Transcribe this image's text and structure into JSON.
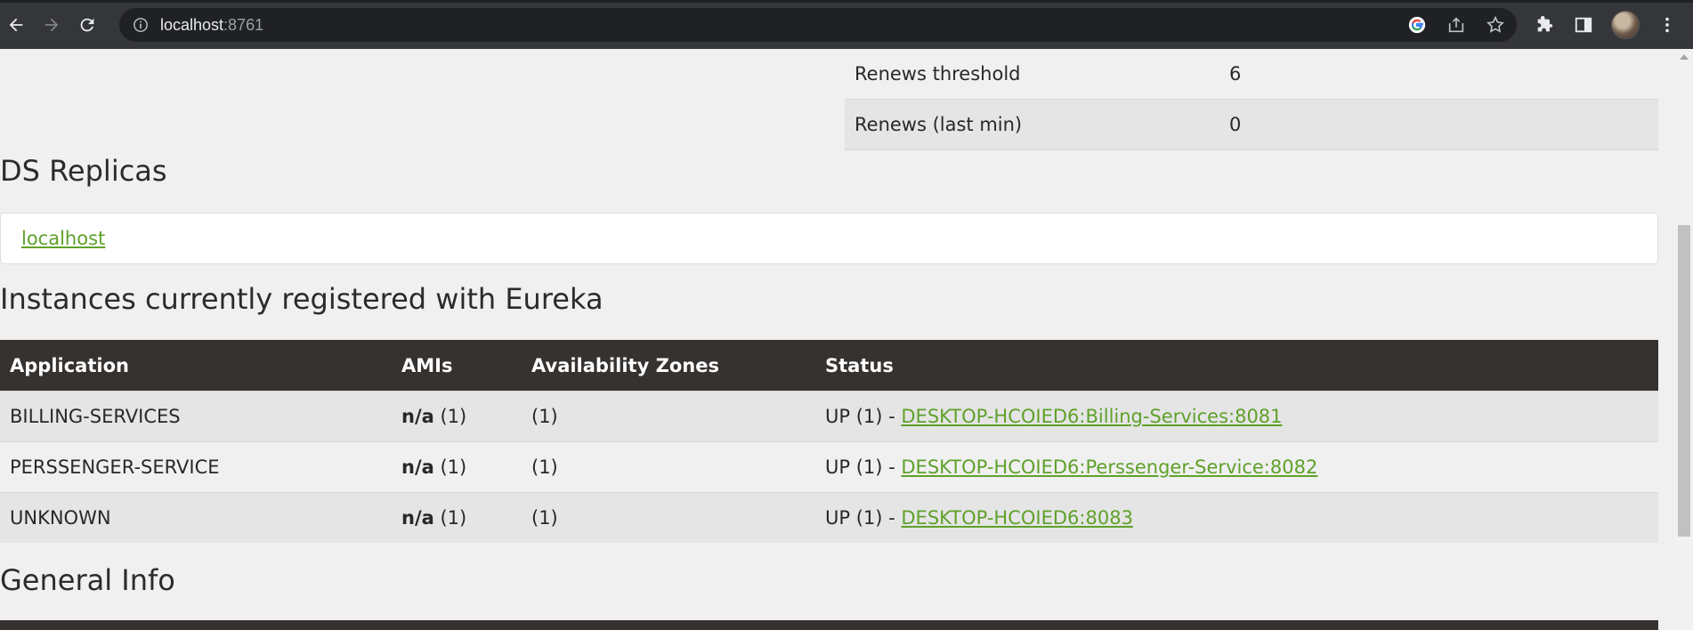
{
  "browser": {
    "url_host": "localhost",
    "url_port": ":8761"
  },
  "stats": [
    {
      "label": "Renews threshold",
      "value": "6"
    },
    {
      "label": "Renews (last min)",
      "value": "0"
    }
  ],
  "ds_replicas": {
    "title": "DS Replicas",
    "link": "localhost"
  },
  "instances": {
    "title": "Instances currently registered with Eureka",
    "headers": [
      "Application",
      "AMIs",
      "Availability Zones",
      "Status"
    ],
    "rows": [
      {
        "app": "BILLING-SERVICES",
        "ami_label": "n/a",
        "ami_count": " (1)",
        "zones": "(1)",
        "status_prefix": "UP (1) - ",
        "status_link": "DESKTOP-HCOIED6:Billing-Services:8081"
      },
      {
        "app": "PERSSENGER-SERVICE",
        "ami_label": "n/a",
        "ami_count": " (1)",
        "zones": "(1)",
        "status_prefix": "UP (1) - ",
        "status_link": "DESKTOP-HCOIED6:Perssenger-Service:8082"
      },
      {
        "app": "UNKNOWN",
        "ami_label": "n/a",
        "ami_count": " (1)",
        "zones": "(1)",
        "status_prefix": "UP (1) - ",
        "status_link": "DESKTOP-HCOIED6:8083"
      }
    ]
  },
  "general_info": {
    "title": "General Info"
  }
}
